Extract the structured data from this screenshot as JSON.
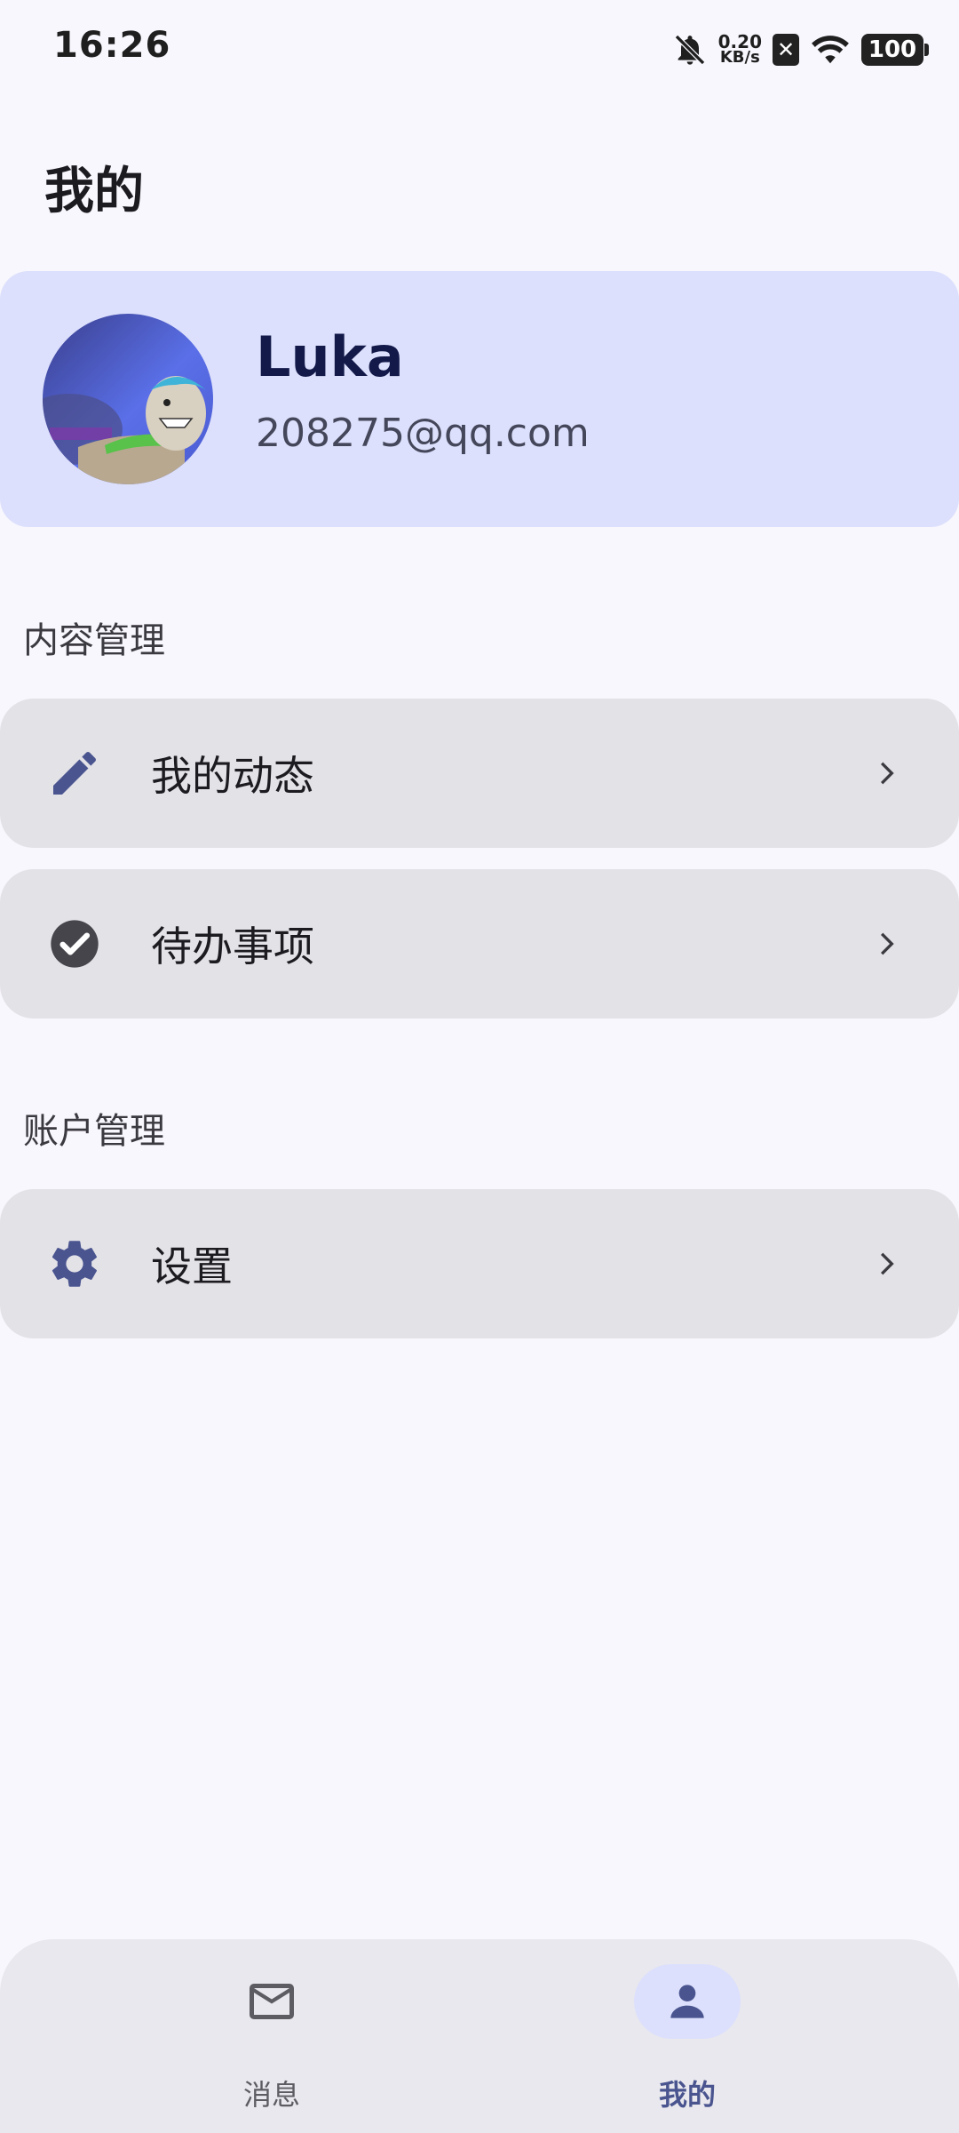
{
  "status_bar": {
    "time": "16:26",
    "net_speed_value": "0.20",
    "net_speed_unit": "KB/s",
    "battery": "100",
    "icons": [
      "bell-off-icon",
      "sim-x-icon",
      "wifi-icon",
      "battery-icon"
    ]
  },
  "page": {
    "title": "我的"
  },
  "profile": {
    "name": "Luka",
    "email": "208275@qq.com"
  },
  "sections": {
    "content": {
      "title": "内容管理",
      "items": [
        {
          "label": "我的动态",
          "icon": "pencil-icon"
        },
        {
          "label": "待办事项",
          "icon": "check-circle-icon"
        }
      ]
    },
    "account": {
      "title": "账户管理",
      "items": [
        {
          "label": "设置",
          "icon": "gear-icon"
        }
      ]
    }
  },
  "bottom_nav": {
    "items": [
      {
        "label": "消息",
        "icon": "mail-icon",
        "active": false
      },
      {
        "label": "我的",
        "icon": "person-icon",
        "active": true
      }
    ]
  },
  "colors": {
    "background": "#f8f7fd",
    "profile_card": "#dce0fc",
    "menu_item": "#e3e2e7",
    "accent": "#4a5590",
    "bottom_nav": "#e9e8ee"
  }
}
